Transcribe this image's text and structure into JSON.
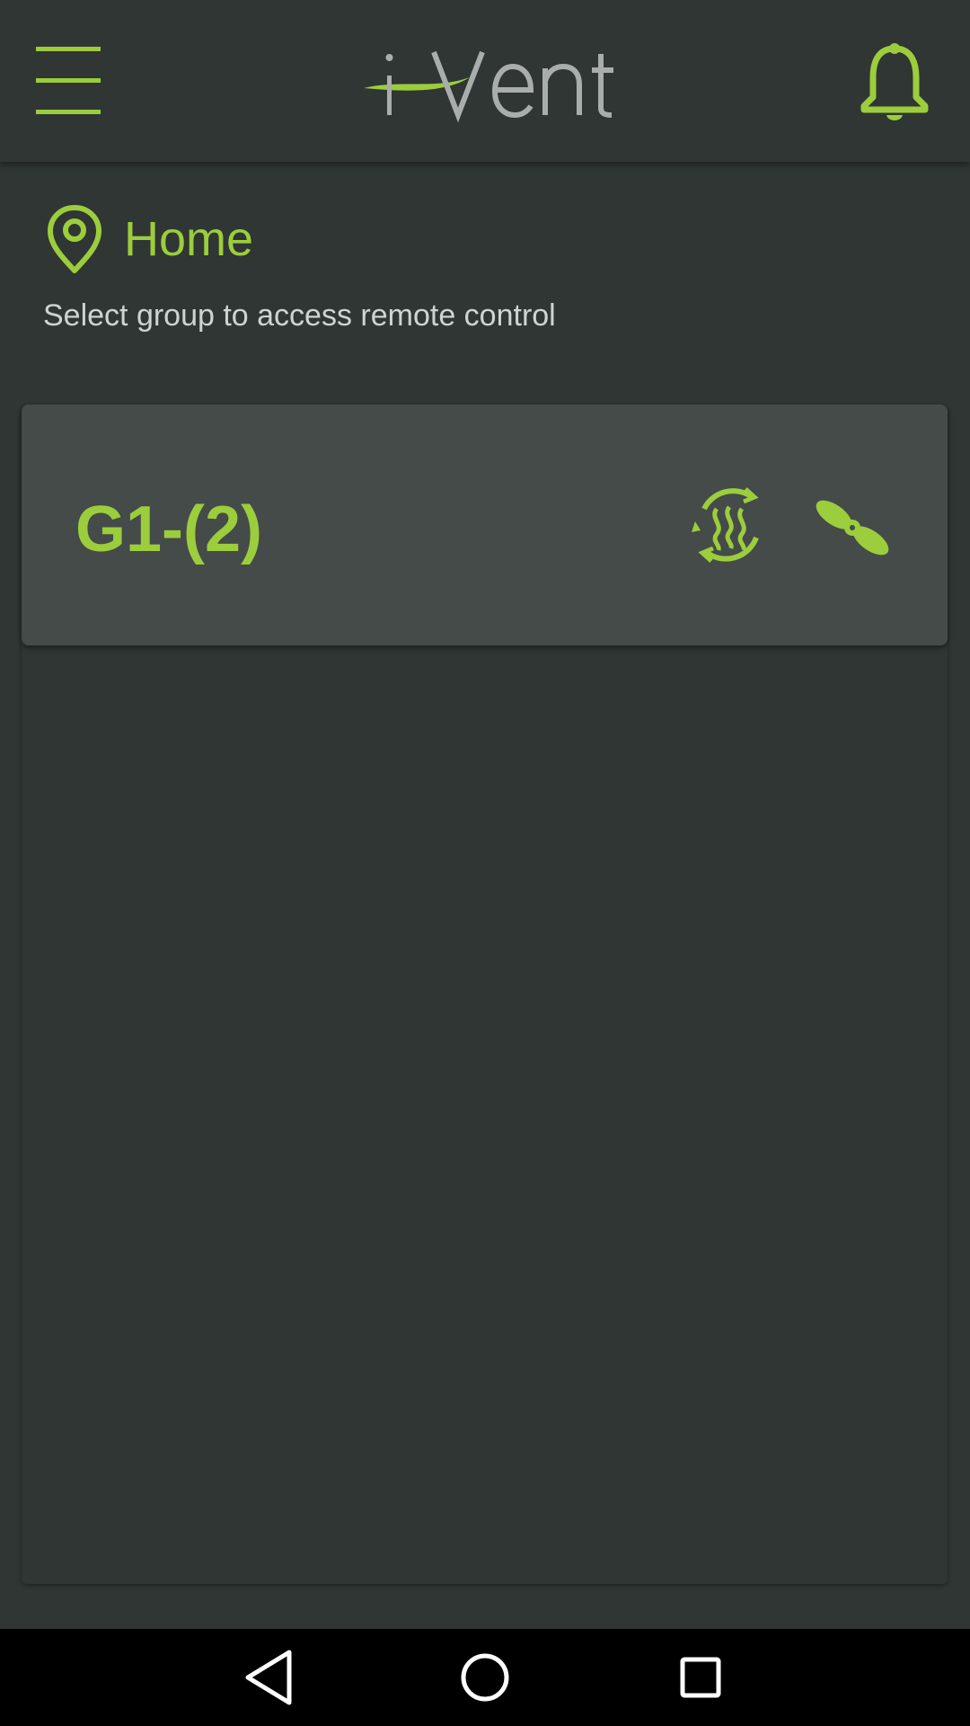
{
  "header": {
    "logo_text": "i-Vent",
    "menu_icon": "hamburger-menu-icon",
    "notification_icon": "bell-icon"
  },
  "location": {
    "icon": "map-pin-icon",
    "title": "Home",
    "subtitle": "Select group to access remote control"
  },
  "groups": [
    {
      "name": "G1-(2)",
      "mode_icons": [
        "heat-recovery-icon",
        "fan-icon"
      ]
    }
  ],
  "system_nav": {
    "back_icon": "back-triangle-icon",
    "home_icon": "home-circle-icon",
    "recents_icon": "recents-square-icon"
  },
  "colors": {
    "accent": "#9ccd3c",
    "background": "#2f3634",
    "card": "#444b49",
    "text_secondary": "#cfd3d2",
    "logo_gray": "#a9adab"
  }
}
